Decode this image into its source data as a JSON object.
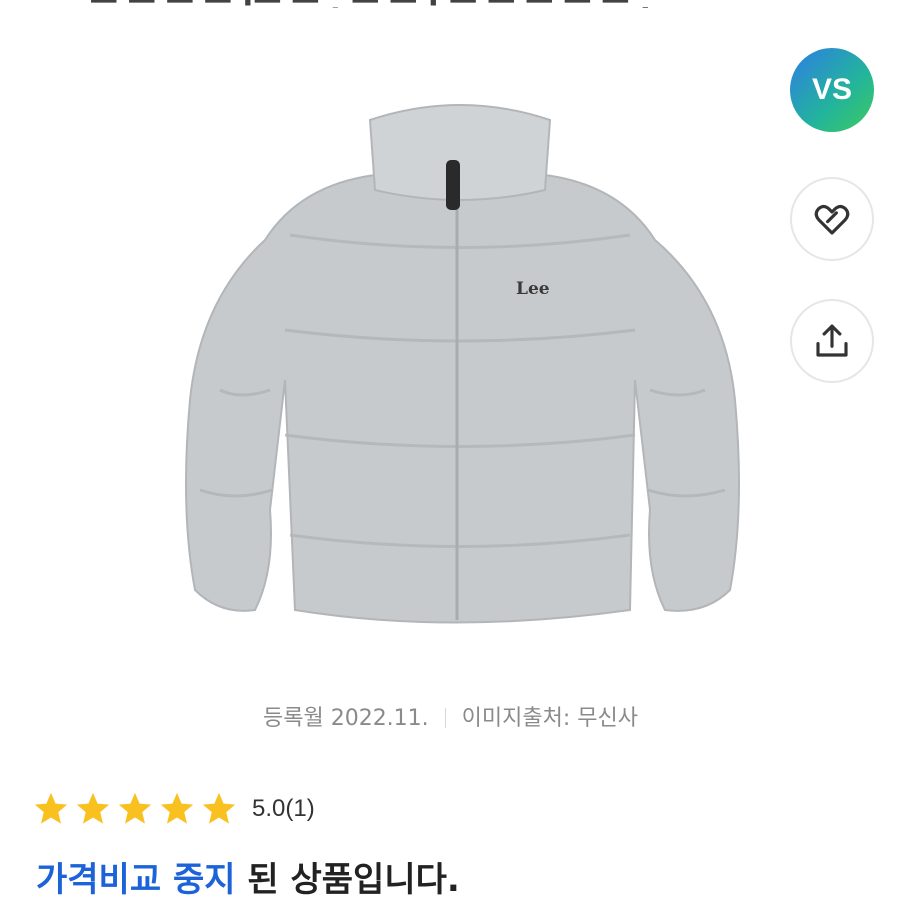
{
  "header": {
    "partial_title": "ㅡ ㅡ ㅡ ㅡ ·ㅡ ㅡ , ㅡ ㅡ · ㅡ ㅡ ㅡ ㅡ ㅡ ."
  },
  "image": {
    "logo_text": "Lee"
  },
  "side_actions": {
    "vs_label": "VS"
  },
  "meta": {
    "registered": "등록월 2022.11.",
    "image_source": "이미지출처: 무신사"
  },
  "rating": {
    "stars": 5,
    "score": "5.0",
    "count": "(1)"
  },
  "notice": {
    "highlight": "가격비교 중지",
    "rest": " 된 상품입니다."
  },
  "colors": {
    "star": "#f8c11f",
    "highlight": "#1c62d9",
    "jacket": "#c7cacd"
  },
  "icons": [
    "vs-badge",
    "heart-icon",
    "share-icon",
    "star-icon"
  ]
}
